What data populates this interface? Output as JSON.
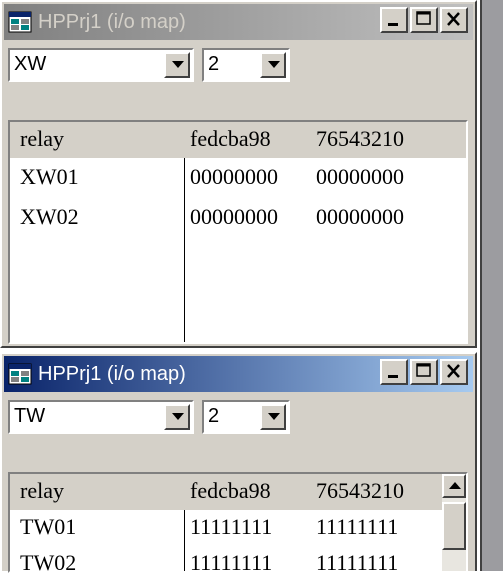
{
  "windows": [
    {
      "title": "HPPrj1 (i/o map)",
      "active": false,
      "combo_type": "XW",
      "combo_count": "2",
      "headers": [
        "relay",
        "fedcba98",
        "76543210"
      ],
      "rows": [
        [
          "XW01",
          "00000000",
          "00000000"
        ],
        [
          "XW02",
          "00000000",
          "00000000"
        ]
      ]
    },
    {
      "title": "HPPrj1 (i/o map)",
      "active": true,
      "combo_type": "TW",
      "combo_count": "2",
      "headers": [
        "relay",
        "fedcba98",
        "76543210"
      ],
      "rows": [
        [
          "TW01",
          "11111111",
          "11111111"
        ],
        [
          "TW02",
          "11111111",
          "11111111"
        ]
      ]
    }
  ],
  "icons": {
    "app": "io-map-app-icon",
    "minimize": "minimize-icon",
    "maximize": "maximize-icon",
    "close": "close-icon",
    "dropdown": "chevron-down-icon",
    "scroll_up": "scroll-up-arrow-icon"
  },
  "colors": {
    "active_title_start": "#0a246a",
    "active_title_end": "#a6caf0",
    "inactive_title_start": "#808080",
    "inactive_title_end": "#c0c0c0",
    "face": "#d4d0c8"
  }
}
